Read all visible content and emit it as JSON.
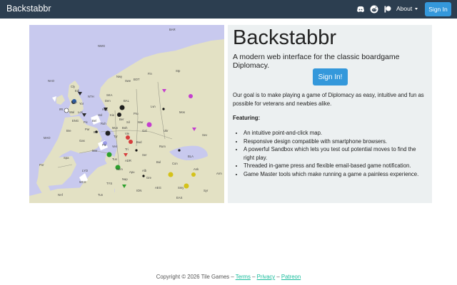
{
  "navbar": {
    "brand": "Backstabbr",
    "icons": [
      "discord-icon",
      "reddit-icon",
      "patreon-icon"
    ],
    "about_label": "About",
    "signin_label": "Sign In"
  },
  "map": {
    "labels": [
      "BAR",
      "NWG",
      "NAO",
      "NTH",
      "Den",
      "Swe",
      "Nwy",
      "BOT",
      "Fin",
      "Stp",
      "SKA",
      "HEL",
      "BAL",
      "Kie",
      "Ber",
      "Pru",
      "Lvn",
      "Mos",
      "Hol",
      "Bel",
      "Mun",
      "Sil",
      "War",
      "ENG",
      "Bur",
      "Boh",
      "Gal",
      "Ukr",
      "Sev",
      "MAO",
      "Par",
      "Tyr",
      "Vie",
      "Bud",
      "Rum",
      "Bre",
      "Gas",
      "Pie",
      "Ven",
      "Tri",
      "Ser",
      "BLA",
      "Spa",
      "Mar",
      "Tus",
      "ADR",
      "Bul",
      "Con",
      "Ank",
      "Arm",
      "LYO",
      "Rom",
      "Apu",
      "Alb",
      "Gre",
      "Smy",
      "WES",
      "TYS",
      "Nap",
      "ION",
      "AEG",
      "EAS",
      "Syr",
      "NAf",
      "Tun",
      "Por",
      "IRI",
      "Lvp",
      "Edi",
      "Cly",
      "Yor",
      "Wal",
      "Lon",
      "Pic",
      "Ruh",
      "Fin",
      "Ank"
    ]
  },
  "hero": {
    "title": "Backstabbr",
    "subtitle": "A modern web interface for the classic boardgame Diplomacy.",
    "signin_label": "Sign In!",
    "goal": "Our goal is to make playing a game of Diplomacy as easy, intuitive and fun as possible for veterans and newbies alike.",
    "featuring": "Featuring:",
    "features": [
      "An intuitive point-and-click map.",
      "Responsive design compatible with smartphone browsers.",
      "A powerful Sandbox which lets you test out potential moves to find the right play.",
      "Threaded in-game press and flexible email-based game notification.",
      "Game Master tools which make running a game a painless experience."
    ]
  },
  "footer": {
    "copyright": "Copyright © 2026 Tile Games –",
    "terms": "Terms",
    "sep1": "–",
    "privacy": "Privacy",
    "sep2": "–",
    "patreon": "Patreon"
  },
  "colors": {
    "navbar": "#2c3e50",
    "accent": "#3498db",
    "link": "#18bc9c",
    "sea": "#c8c9ee",
    "land": "#e3e1c4",
    "panel": "#ecf0f1"
  }
}
